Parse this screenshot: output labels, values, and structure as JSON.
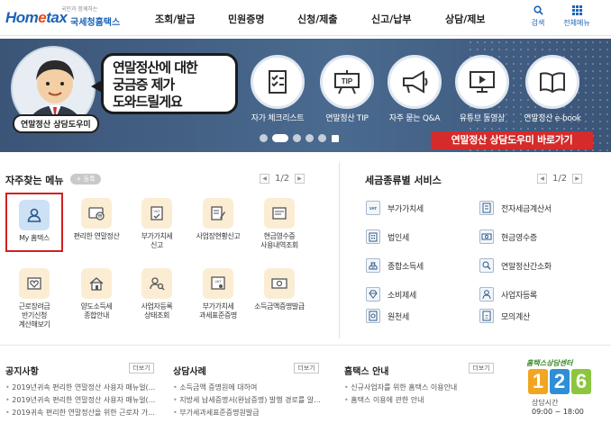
{
  "header": {
    "logo_small": "국민과 함께하는",
    "logo_brand_a": "Hom",
    "logo_brand_e": "e",
    "logo_brand_b": "tax",
    "logo_kr": "국세청홈택스",
    "nav": [
      "조회/발급",
      "민원증명",
      "신청/제출",
      "신고/납부",
      "상담/제보"
    ],
    "search_label": "검색",
    "allmenu_label": "전체메뉴"
  },
  "banner": {
    "speech_lines": [
      "연말정산에 대한",
      "궁금증 제가",
      "도와드릴게요"
    ],
    "character_tag": "연말정산 상담도우미",
    "quick_items": [
      "자가 체크리스트",
      "연말정산 TIP",
      "자주 묻는 Q&A",
      "유튜브 동영상",
      "연말정산 e-book"
    ],
    "shortcut": "연말정산 상담도우미 바로가기",
    "carousel_count": 5,
    "carousel_active": 1
  },
  "favorites": {
    "title": "자주찾는 메뉴",
    "register": "+ 등록",
    "page": "1/2",
    "items": [
      {
        "label1": "My 홈택스",
        "label2": ""
      },
      {
        "label1": "편리한 연말정산",
        "label2": ""
      },
      {
        "label1": "부가가치세",
        "label2": "신고"
      },
      {
        "label1": "사업장현황신고",
        "label2": ""
      },
      {
        "label1": "현금영수증",
        "label2": "사용내역조회"
      },
      {
        "label1": "근로장려금",
        "label2": "반기신청",
        "label3": "계산해보기"
      },
      {
        "label1": "양도소득세",
        "label2": "종합안내"
      },
      {
        "label1": "사업자등록",
        "label2": "상태조회"
      },
      {
        "label1": "부가가치세",
        "label2": "과세표준증명"
      },
      {
        "label1": "소득금액증명발급",
        "label2": ""
      }
    ]
  },
  "taxes": {
    "title": "세금종류별 서비스",
    "page": "1/2",
    "items": [
      {
        "icon": "VAT",
        "label": "부가가치세"
      },
      {
        "icon": "전",
        "label": "전자세금계산서"
      },
      {
        "icon": "법",
        "label": "법인세"
      },
      {
        "icon": "현",
        "label": "현금영수증"
      },
      {
        "icon": "₩",
        "label": "종합소득세"
      },
      {
        "icon": "연",
        "label": "연말정산간소화"
      },
      {
        "icon": "◆",
        "label": "소비제세"
      },
      {
        "icon": "사",
        "label": "사업자등록"
      },
      {
        "icon": "원",
        "label": "원천세"
      },
      {
        "icon": "±",
        "label": "모의계산"
      }
    ]
  },
  "bottom": {
    "notice": {
      "title": "공지사항",
      "more": "더보기",
      "items": [
        "2019년귀속 편리한 연말정산 사용자 매뉴얼(...",
        "2019년귀속 편리한 연말정산 사용자 매뉴얼(...",
        "2019귀속 편리한 연말정산을 위한 근로자 가..."
      ]
    },
    "consult": {
      "title": "상담사례",
      "more": "더보기",
      "items": [
        "소득금액 증명원에 대하여",
        "지방세 납세증명서(완납증명) 발행 경로를 알...",
        "부가세과세표준증명원발급"
      ]
    },
    "guide": {
      "title": "홈택스 안내",
      "more": "더보기",
      "items": [
        "신규사업자를 위한 홈택스 이용안내",
        "홈택스 이용에 관한 안내"
      ]
    },
    "callcenter": {
      "name": "홈택스상담센터",
      "digits": [
        "1",
        "2",
        "6"
      ],
      "hours_label": "상담시간",
      "hours": "09:00 ~ 18:00"
    }
  }
}
